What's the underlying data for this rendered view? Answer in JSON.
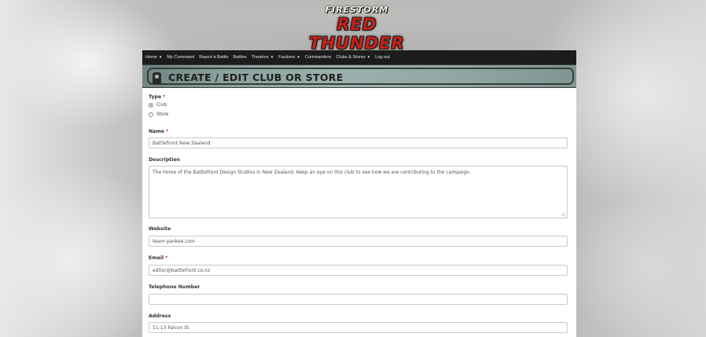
{
  "logo": {
    "top": "FIRESTORM",
    "main": "RED THUNDER"
  },
  "nav": [
    {
      "label": "Home",
      "dropdown": true
    },
    {
      "label": "My Command",
      "dropdown": false
    },
    {
      "label": "Report a Battle",
      "dropdown": false
    },
    {
      "label": "Battles",
      "dropdown": false
    },
    {
      "label": "Theatres",
      "dropdown": true
    },
    {
      "label": "Factions",
      "dropdown": true
    },
    {
      "label": "Commanders",
      "dropdown": false
    },
    {
      "label": "Clubs & Stores",
      "dropdown": true
    },
    {
      "label": "Log out",
      "dropdown": false
    }
  ],
  "page_title": "CREATE / EDIT CLUB OR STORE",
  "form": {
    "type": {
      "label": "Type",
      "required_mark": "*",
      "options": [
        "Club",
        "Store"
      ],
      "selected": "Club"
    },
    "name": {
      "label": "Name",
      "required_mark": "*",
      "value": "Battlefront New Zealand"
    },
    "description": {
      "label": "Description",
      "value": "The home of the Battlefront Design Studios in New Zealand. Keep an eye on this club to see how we are contributing to the campaign."
    },
    "website": {
      "label": "Website",
      "value": "team-yankee.com"
    },
    "email": {
      "label": "Email",
      "required_mark": "*",
      "value": "editor@battlefront.co.nz"
    },
    "telephone": {
      "label": "Telephone Number",
      "value": ""
    },
    "address": {
      "label": "Address",
      "value": "11-13 Falcon St"
    }
  },
  "colors": {
    "navbar": "#1c1c1c",
    "banner": "#8aa09c",
    "required": "#c9302c",
    "radio_selected": "#2c5fb3"
  }
}
